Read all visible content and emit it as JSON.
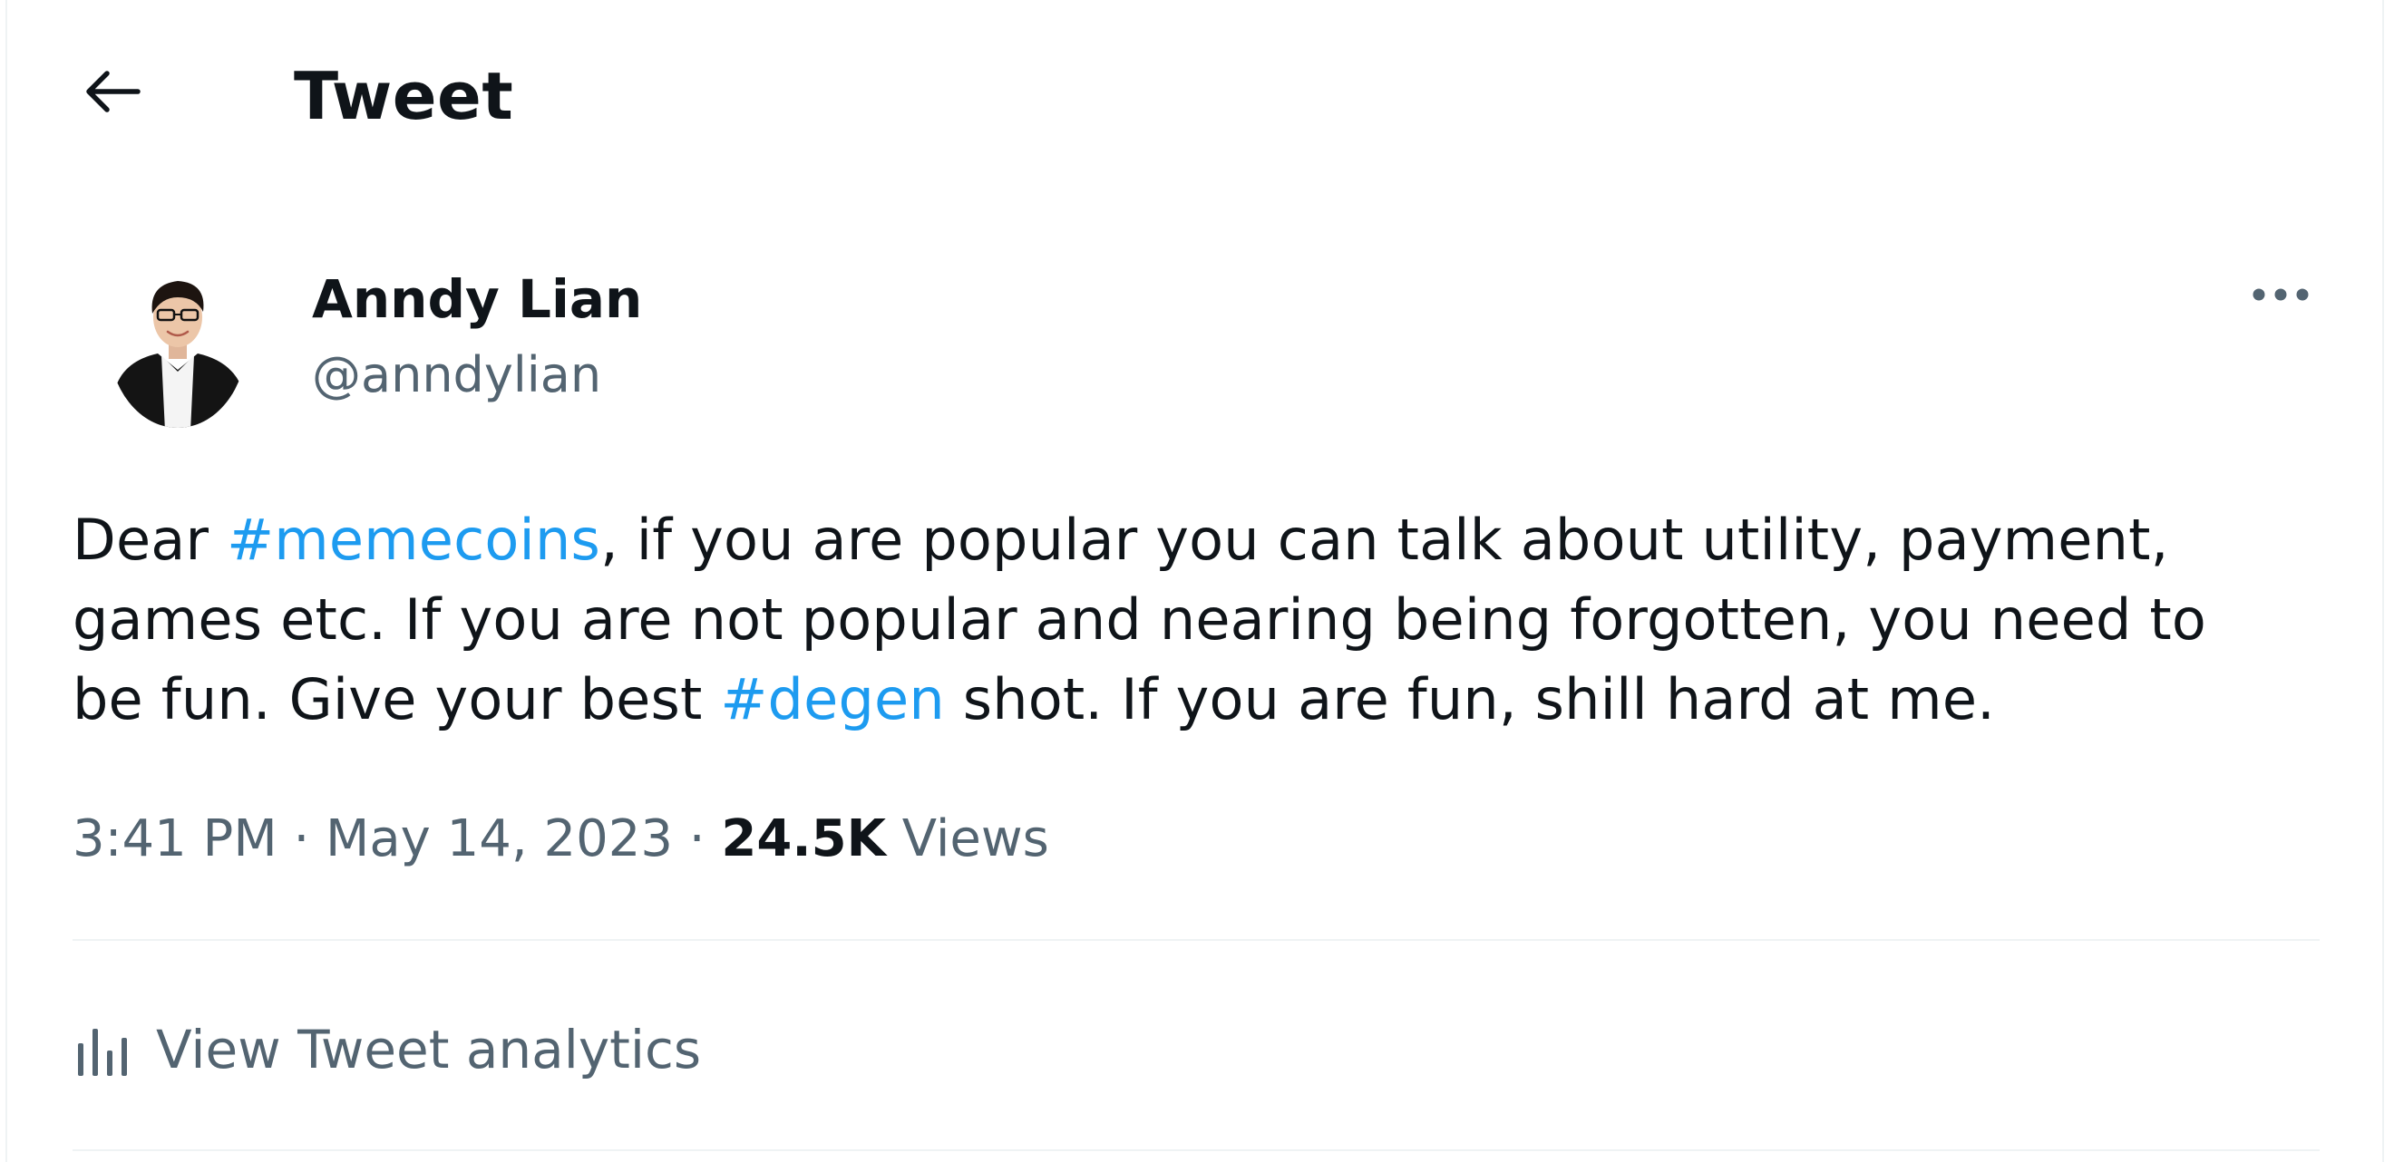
{
  "colors": {
    "text": "#0f1419",
    "secondary": "#536471",
    "accent": "#1d9bf0",
    "divider": "#eff3f4"
  },
  "header": {
    "back_icon": "arrow-left-icon",
    "title": "Tweet"
  },
  "author": {
    "name": "Anndy Lian",
    "handle": "@anndylian",
    "avatar_icon": "profile-photo",
    "more_icon": "more-horizontal-icon"
  },
  "tweet": {
    "lines": [
      {
        "pre": "Dear ",
        "tag": "#memecoins",
        "post": ", if you are popular you can talk about utility, payment,"
      },
      {
        "pre": "games etc. If you are not popular and nearing being forgotten, you need to",
        "tag": "",
        "post": ""
      },
      {
        "pre": "be fun. Give your best ",
        "tag": "#degen",
        "post": " shot. If you are fun, shill hard at me."
      }
    ]
  },
  "meta": {
    "time": "3:41 PM",
    "sep1": " · ",
    "date": "May 14, 2023",
    "sep2": " · ",
    "views_count": "24.5K",
    "views_label": " Views"
  },
  "analytics": {
    "icon": "bar-chart-icon",
    "label": "View Tweet analytics"
  }
}
